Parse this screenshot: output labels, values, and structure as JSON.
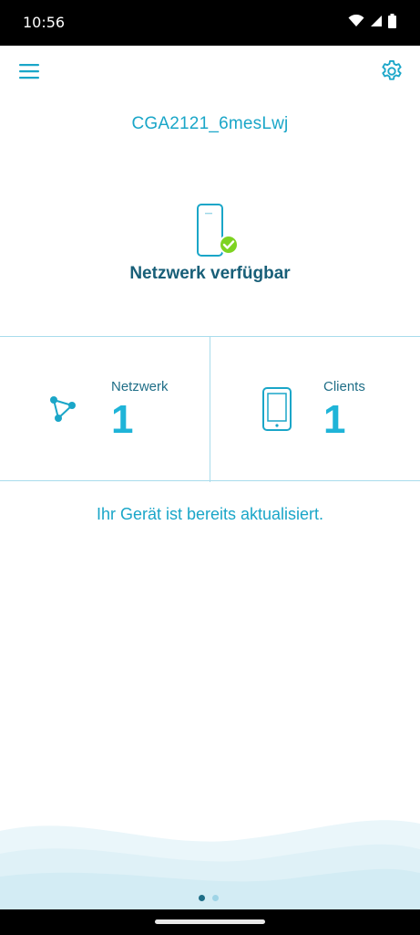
{
  "status_bar": {
    "time": "10:56",
    "icons": [
      "wifi-icon",
      "cell-signal-icon",
      "battery-icon"
    ]
  },
  "app_bar": {
    "menu_icon": "menu-icon",
    "settings_icon": "gear-icon"
  },
  "device": {
    "name": "CGA2121_6mesLwj"
  },
  "network_status": {
    "label": "Netzwerk verfügbar",
    "icon": "phone-check-icon",
    "check_color": "#7ed321"
  },
  "stats": {
    "network": {
      "label": "Netzwerk",
      "value": "1",
      "icon": "network-nodes-icon"
    },
    "clients": {
      "label": "Clients",
      "value": "1",
      "icon": "phone-icon"
    }
  },
  "update_message": "Ihr Gerät ist bereits aktualisiert.",
  "pager": {
    "pages": 2,
    "active": 0
  },
  "colors": {
    "accent": "#1aa6c8",
    "accent_dark": "#185f78",
    "divider": "#a9dcec",
    "success": "#7ed321"
  }
}
